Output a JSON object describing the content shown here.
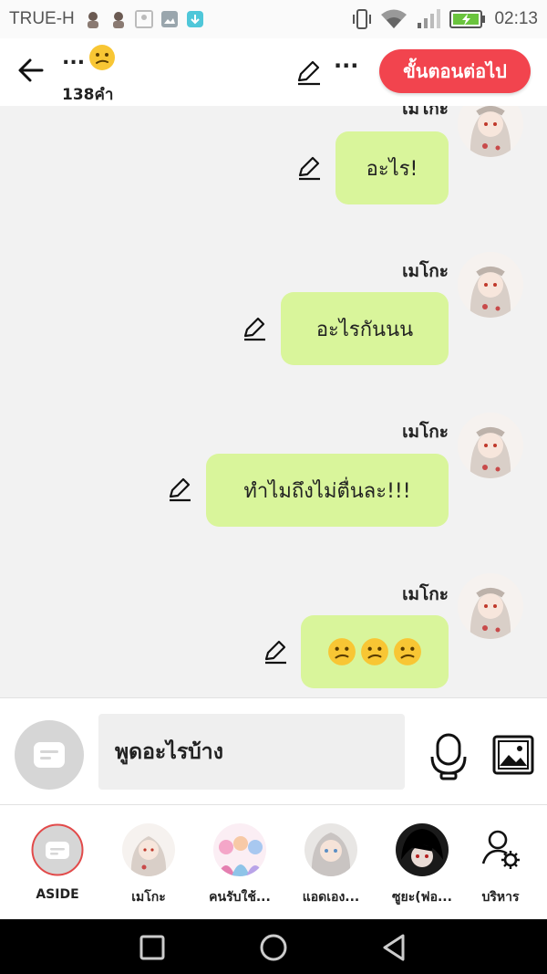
{
  "status_bar": {
    "carrier": "TRUE-H",
    "time": "02:13",
    "icons": [
      "avatar-notification-icon",
      "avatar-notification-icon",
      "image-notification-icon",
      "gallery-notification-icon",
      "download-notification-icon",
      "vibrate-icon",
      "wifi-icon",
      "signal-icon",
      "battery-charging-icon"
    ]
  },
  "header": {
    "title": "...",
    "title_emoji": "confused-face-icon",
    "word_count": "138คำ",
    "next_label": "ขั้นตอนต่อไป",
    "more_label": "···",
    "next_button_color": "#f2444e"
  },
  "chat": {
    "bubble_color": "#d9f59b",
    "messages": [
      {
        "name": "เมโกะ",
        "text": "อะไร!"
      },
      {
        "name": "เมโกะ",
        "text": "อะไรกันนน"
      },
      {
        "name": "เมโกะ",
        "text": "ทำไมถึงไม่ตื่นละ!!!"
      },
      {
        "name": "เมโกะ",
        "text": "",
        "emojis": [
          "confused-face-icon",
          "confused-face-icon",
          "confused-face-icon"
        ]
      }
    ]
  },
  "composer": {
    "placeholder": "พูดอะไรบ้าง",
    "icons": [
      "chat-toggle-icon",
      "microphone-icon",
      "image-icon"
    ]
  },
  "characters": [
    {
      "label": "ASIDE",
      "icon": "aside-chat-icon"
    },
    {
      "label": "เมโกะ",
      "icon": "avatar"
    },
    {
      "label": "คนรับใช้...",
      "icon": "avatar"
    },
    {
      "label": "แอดเอง...",
      "icon": "avatar"
    },
    {
      "label": "ซูยะ(ฟอ...",
      "icon": "avatar"
    },
    {
      "label": "บริหาร",
      "icon": "manage-characters-icon"
    }
  ],
  "nav": {
    "icons": [
      "recent-apps-icon",
      "home-icon",
      "back-icon"
    ]
  }
}
